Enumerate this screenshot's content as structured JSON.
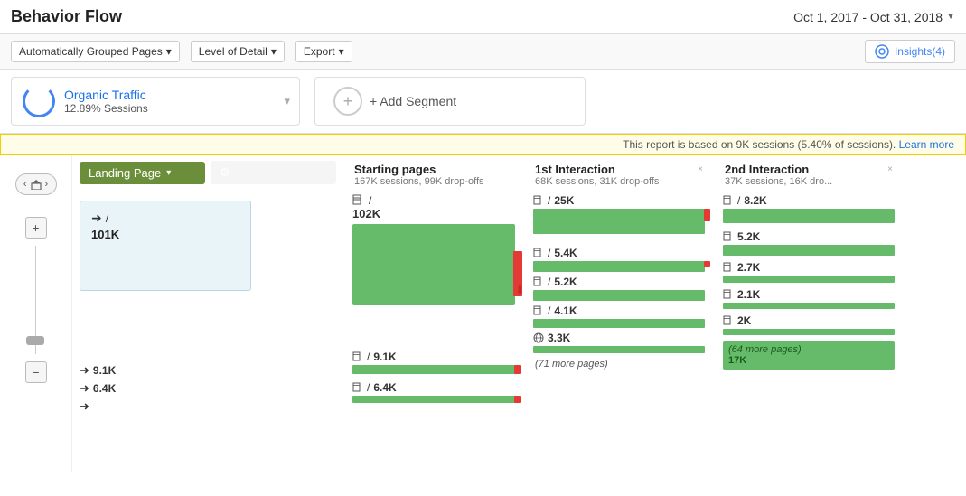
{
  "header": {
    "title": "Behavior Flow",
    "date_range": "Oct 1, 2017 - Oct 31, 2018",
    "dropdown_arrow": "▼"
  },
  "toolbar": {
    "grouped_pages_label": "Automatically Grouped Pages",
    "level_of_detail_label": "Level of Detail",
    "export_label": "Export",
    "insights_label": "Insights(4)"
  },
  "segments": {
    "organic": {
      "name": "Organic Traffic",
      "stat": "12.89% Sessions"
    },
    "add_segment": "+ Add Segment"
  },
  "notice": {
    "text": "This report is based on 9K sessions (5.40% of sessions).",
    "link": "Learn more"
  },
  "flow": {
    "landing_col": {
      "header": "Landing Page",
      "root_node": {
        "label": "/",
        "count": "101K"
      }
    },
    "starting_pages": {
      "title": "Starting pages",
      "subtitle": "167K sessions, 99K drop-offs",
      "main_node": {
        "label": "/",
        "count": "102K"
      },
      "nodes": [
        {
          "label": "/",
          "count": "9.1K"
        },
        {
          "label": "/",
          "count": "6.4K"
        }
      ]
    },
    "interaction1": {
      "title": "1st Interaction",
      "subtitle": "68K sessions, 31K drop-offs",
      "close": "×",
      "nodes": [
        {
          "label": "/",
          "count": "25K"
        },
        {
          "label": "/",
          "count": "5.4K"
        },
        {
          "label": "/",
          "count": "5.2K"
        },
        {
          "label": "/",
          "count": "4.1K"
        },
        {
          "label": "/",
          "count": "3.3K"
        },
        {
          "more": "(71 more pages)",
          "count": ""
        }
      ]
    },
    "interaction2": {
      "title": "2nd Interaction",
      "subtitle": "37K sessions, 16K dro...",
      "close": "×",
      "nodes": [
        {
          "label": "/",
          "count": "8.2K"
        },
        {
          "label": "/",
          "count": "5.2K"
        },
        {
          "label": "/",
          "count": "2.7K"
        },
        {
          "label": "/",
          "count": "2.1K"
        },
        {
          "label": "/",
          "count": "2K"
        },
        {
          "more": "(64 more pages)",
          "count": "17K"
        }
      ]
    }
  }
}
